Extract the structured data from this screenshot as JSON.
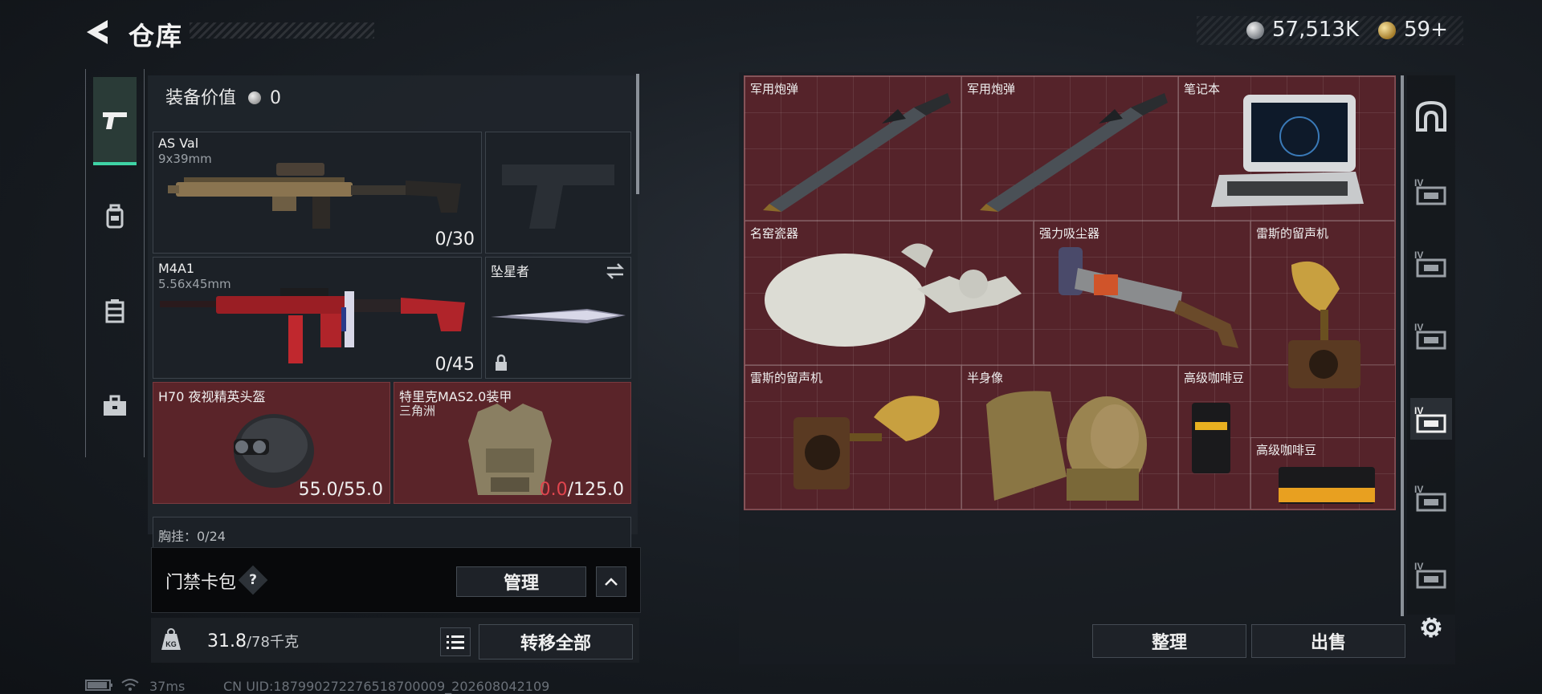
{
  "header": {
    "title": "仓库",
    "silver_amount": "57,513K",
    "gold_amount": "59+"
  },
  "left_tabs": [
    {
      "name": "weapons",
      "icon": "pistol-icon",
      "active": true
    },
    {
      "name": "backpack",
      "icon": "backpack-icon",
      "active": false
    },
    {
      "name": "vest",
      "icon": "vest-icon",
      "active": false
    },
    {
      "name": "case",
      "icon": "briefcase-icon",
      "active": false
    }
  ],
  "equipment": {
    "value_label": "装备价值",
    "value": "0",
    "slots": [
      {
        "name": "AS Val",
        "sub": "9x39mm",
        "count": "0/30"
      },
      {
        "name": "M4A1",
        "sub": "5.56x45mm",
        "count": "0/45"
      },
      {
        "name": "坠星者"
      },
      {
        "name": "H70 夜视精英头盔",
        "count": "55.0/55.0"
      },
      {
        "name": "特里克MAS2.0装甲",
        "sub": "三角洲",
        "count_current": "0.0",
        "count_max": "/125.0"
      }
    ],
    "partial_label": "胸挂：0/24"
  },
  "card_bag": {
    "label": "门禁卡包",
    "help": "?",
    "manage_label": "管理"
  },
  "weight": {
    "current": "31.8",
    "max": "/78千克",
    "transfer_all_label": "转移全部"
  },
  "status": {
    "ping": "37ms",
    "uid": "CN UID:187990272276518700009_202608042109"
  },
  "storage": {
    "items": [
      {
        "name": "军用炮弹"
      },
      {
        "name": "军用炮弹"
      },
      {
        "name": "笔记本"
      },
      {
        "name": "名窑瓷器"
      },
      {
        "name": "强力吸尘器"
      },
      {
        "name": "雷斯的留声机"
      },
      {
        "name": "雷斯的留声机"
      },
      {
        "name": "半身像"
      },
      {
        "name": "高级咖啡豆"
      },
      {
        "name": "高级咖啡豆"
      }
    ],
    "sort_label": "整理",
    "sell_label": "出售"
  },
  "right_tabs": [
    {
      "icon": "arch-icon"
    },
    {
      "icon": "case-iv-icon",
      "label": "IV"
    },
    {
      "icon": "case-iv-icon",
      "label": "IV"
    },
    {
      "icon": "case-iv-icon",
      "label": "IV"
    },
    {
      "icon": "case-iv-icon",
      "label": "IV",
      "active": true
    },
    {
      "icon": "case-iv-icon",
      "label": "IV"
    },
    {
      "icon": "case-iv-icon",
      "label": "IV"
    }
  ],
  "colors": {
    "accent_green": "#3fd4a6",
    "grid_red": "#55232a",
    "durability_red": "#e0454e"
  }
}
